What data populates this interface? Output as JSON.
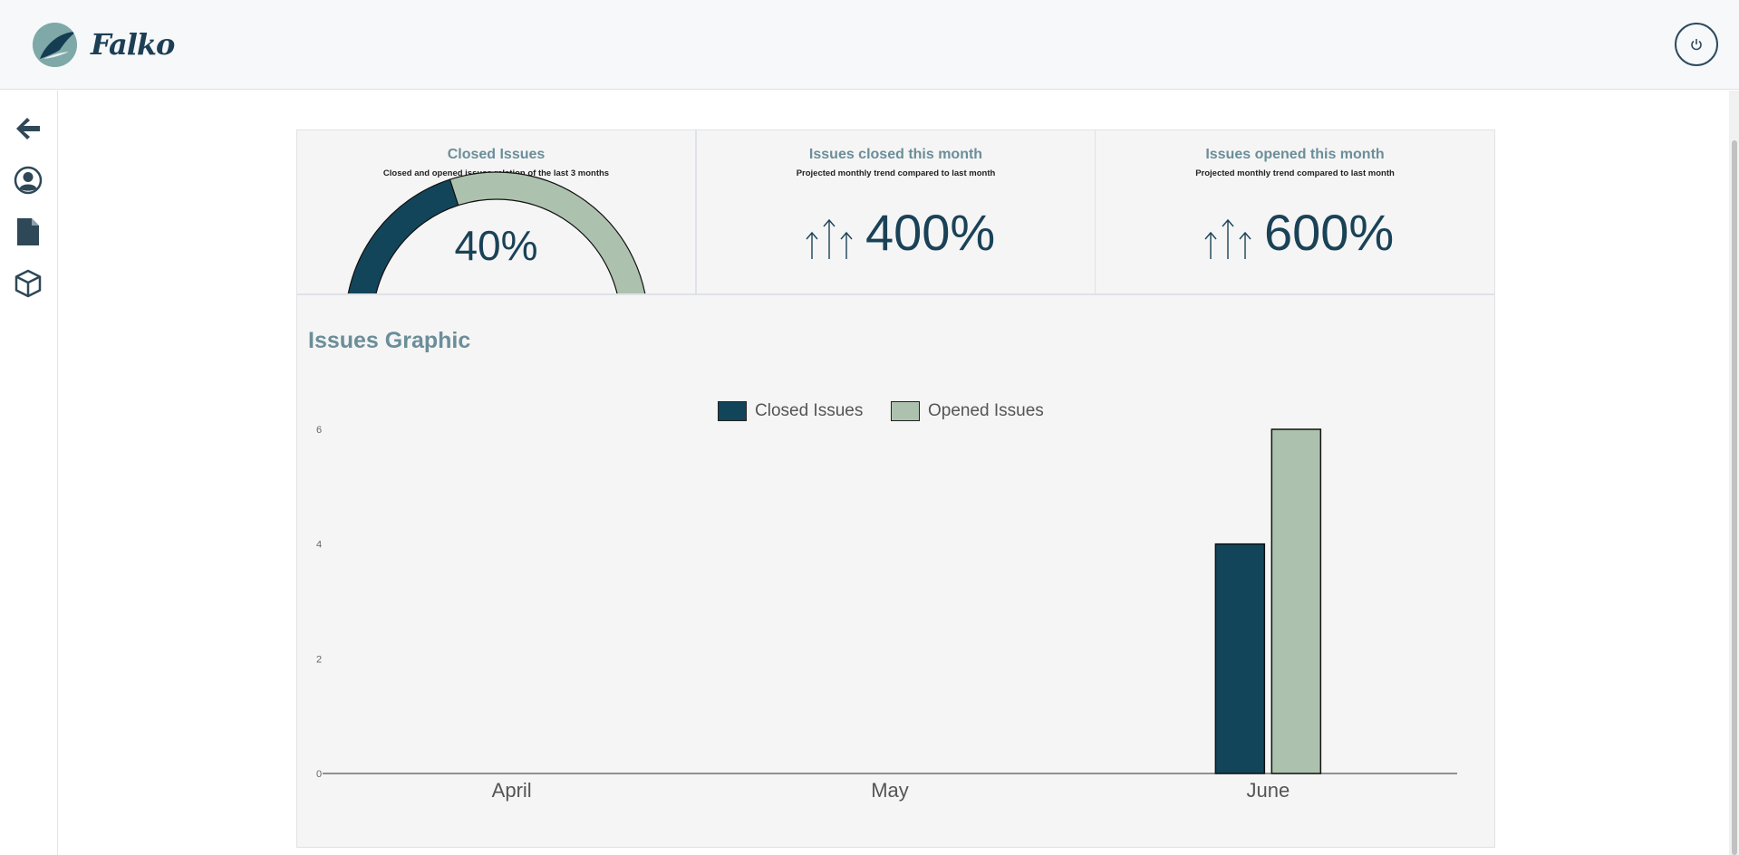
{
  "header": {
    "brand": "Falko",
    "logo_icon": "falcon-logo-icon",
    "power_icon": "power-icon"
  },
  "sidebar": {
    "items": [
      {
        "icon": "arrow-left-icon"
      },
      {
        "icon": "user-circle-icon"
      },
      {
        "icon": "file-icon"
      },
      {
        "icon": "cube-icon"
      }
    ]
  },
  "cards": {
    "closed": {
      "title": "Closed Issues",
      "subtitle": "Closed and opened issues relation of the last 3 months",
      "value": "40%",
      "gauge_fraction": 0.4
    },
    "closed_month": {
      "title": "Issues closed this month",
      "subtitle": "Projected monthly trend compared to last month",
      "value": "400%"
    },
    "opened_month": {
      "title": "Issues opened this month",
      "subtitle": "Projected monthly trend compared to last month",
      "value": "600%"
    }
  },
  "colors": {
    "closed": "#12455a",
    "opened": "#adc2ae",
    "accent": "#6b8e99"
  },
  "chart_data": {
    "type": "bar",
    "title": "Issues Graphic",
    "categories": [
      "April",
      "May",
      "June"
    ],
    "series": [
      {
        "name": "Closed Issues",
        "values": [
          0,
          0,
          4
        ],
        "color": "#12455a"
      },
      {
        "name": "Opened Issues",
        "values": [
          0,
          0,
          6
        ],
        "color": "#adc2ae"
      }
    ],
    "yticks": [
      "0",
      "2",
      "4",
      "6"
    ],
    "ylim": [
      0,
      6
    ],
    "legend": "top-center",
    "grid": false
  }
}
